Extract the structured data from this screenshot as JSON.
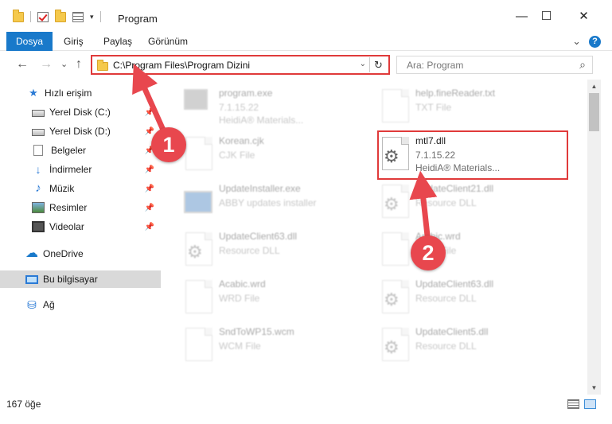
{
  "window": {
    "title": "Program",
    "minimize_glyph": "—",
    "maximize_glyph": "☐",
    "close_glyph": "✕",
    "qat_dropdown_glyph": "▾"
  },
  "ribbon": {
    "tabs": [
      "Dosya",
      "Giriş",
      "Paylaş",
      "Görünüm"
    ],
    "active_tab_color": "#1979ca",
    "expand_glyph": "⌄",
    "help_glyph": "?"
  },
  "nav": {
    "back_glyph": "←",
    "forward_glyph": "→",
    "recent_glyph": "⌄",
    "up_glyph": "↑",
    "address": "C:\\Program Files\\Program Dizini",
    "address_dropdown_glyph": "⌄",
    "refresh_glyph": "↻",
    "search_placeholder": "Ara: Program",
    "search_glyph": "⌕"
  },
  "sidebar": {
    "items": [
      {
        "label": "Hızlı erişim",
        "icon": "star-icon",
        "pinned": false
      },
      {
        "label": "Yerel Disk (C:)",
        "icon": "drive-icon",
        "pinned": true
      },
      {
        "label": "Yerel Disk (D:)",
        "icon": "drive-icon",
        "pinned": true
      },
      {
        "label": "Belgeler",
        "icon": "documents-icon",
        "pinned": true
      },
      {
        "label": "İndirmeler",
        "icon": "downloads-icon",
        "pinned": true
      },
      {
        "label": "Müzik",
        "icon": "music-icon",
        "pinned": true
      },
      {
        "label": "Resimler",
        "icon": "pictures-icon",
        "pinned": true
      },
      {
        "label": "Videolar",
        "icon": "videos-icon",
        "pinned": true
      },
      {
        "label": "OneDrive",
        "icon": "onedrive-icon",
        "pinned": false
      },
      {
        "label": "Bu bilgisayar",
        "icon": "this-pc-icon",
        "pinned": false,
        "selected": true
      },
      {
        "label": "Ağ",
        "icon": "network-icon",
        "pinned": false
      }
    ],
    "pin_glyph": "📌"
  },
  "files": [
    {
      "name": "program.exe",
      "line2": "7.1.15.22",
      "line3": "HeidiA® Materials...",
      "icon": "exe-icon"
    },
    {
      "name": "help.fineReader.txt",
      "line2": "TXT File",
      "line3": "",
      "icon": "text-file-icon"
    },
    {
      "name": "Korean.cjk",
      "line2": "CJK File",
      "line3": "",
      "icon": "generic-file-icon"
    },
    {
      "name": "mtl7.dll",
      "line2": "7.1.15.22",
      "line3": "HeidiA® Materials...",
      "icon": "dll-gear-icon",
      "highlighted": true
    },
    {
      "name": "UpdateInstaller.exe",
      "line2": "ABBY updates installer",
      "line3": "",
      "icon": "installer-icon"
    },
    {
      "name": "UpdateClient21.dll",
      "line2": "Resource DLL",
      "line3": "",
      "icon": "dll-gear-icon"
    },
    {
      "name": "UpdateClient63.dll",
      "line2": "Resource DLL",
      "line3": "",
      "icon": "generic-file-icon"
    },
    {
      "name": "Arabic.wrd",
      "line2": "WRD File",
      "line3": "",
      "icon": "generic-file-icon"
    },
    {
      "name": "Acabic.wrd",
      "line2": "WRD File",
      "line3": "",
      "icon": "generic-file-icon"
    },
    {
      "name": "UpdateClient63.dll",
      "line2": "Resource DLL",
      "line3": "",
      "icon": "dll-gear-icon"
    },
    {
      "name": "SndToWP15.wcm",
      "line2": "WCM File",
      "line3": "",
      "icon": "generic-file-icon"
    },
    {
      "name": "UpdateClient5.dll",
      "line2": "Resource DLL",
      "line3": "",
      "icon": "dll-gear-icon"
    }
  ],
  "file_glyphs": {
    "gear": "⚙"
  },
  "scrollbar": {
    "up_glyph": "▲",
    "down_glyph": "▼"
  },
  "status": {
    "item_count": "167 öğe"
  },
  "annotations": {
    "marker1": "1",
    "marker2": "2",
    "color": "#e8474e"
  }
}
